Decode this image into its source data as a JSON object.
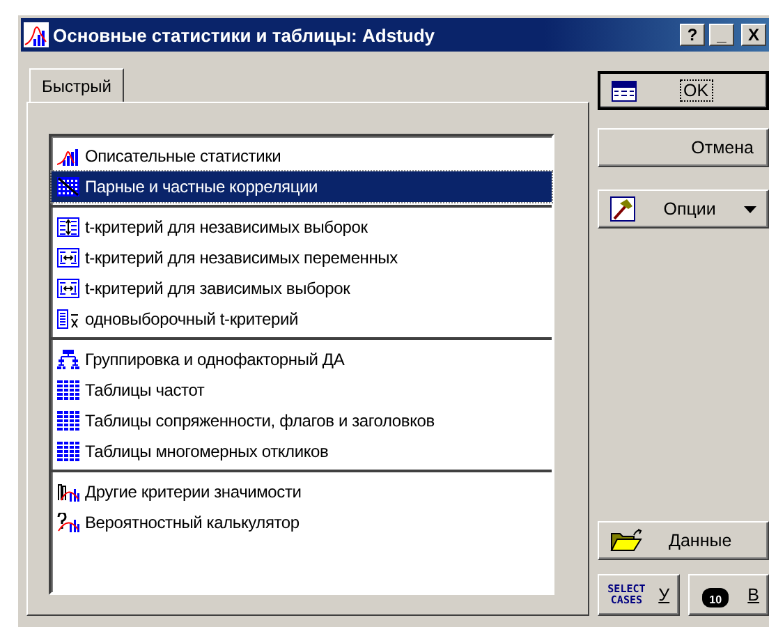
{
  "window": {
    "title": "Основные статистики и таблицы: Adstudy",
    "controls": [
      "?",
      "_",
      "X"
    ]
  },
  "tabs": [
    {
      "label": "Быстрый",
      "selected": true
    }
  ],
  "list": {
    "groups": [
      [
        {
          "label": "Описательные статистики",
          "kind": "histogram",
          "selected": false
        },
        {
          "label": "Парные и частные корреляции",
          "kind": "matrix",
          "selected": true
        }
      ],
      [
        {
          "label": "t-критерий для независимых выборок",
          "kind": "updown",
          "selected": false
        },
        {
          "label": "t-критерий для независимых переменных",
          "kind": "arrows",
          "selected": false
        },
        {
          "label": "t-критерий для зависимых выборок",
          "kind": "arrows",
          "selected": false
        },
        {
          "label": "одновыборочный t-критерий",
          "kind": "mean",
          "selected": false
        }
      ],
      [
        {
          "label": "Группировка и однофакторный ДА",
          "kind": "tree",
          "selected": false
        },
        {
          "label": "Таблицы частот",
          "kind": "table",
          "selected": false
        },
        {
          "label": "Таблицы сопряженности, флагов и заголовков",
          "kind": "table",
          "selected": false
        },
        {
          "label": "Таблицы многомерных откликов",
          "kind": "table",
          "selected": false
        }
      ],
      [
        {
          "label": "Другие критерии значимости",
          "kind": "tests",
          "selected": false
        },
        {
          "label": "Вероятностный калькулятор",
          "kind": "calculator",
          "selected": false
        }
      ]
    ]
  },
  "buttons": {
    "ok": "OK",
    "cancel": "Отмена",
    "options": "Опции",
    "data": "Данные",
    "select_cases": {
      "icon_text": [
        "SELECT",
        "CASES"
      ],
      "label": "У"
    },
    "weight": {
      "icon_text": "10",
      "label": "В"
    }
  }
}
